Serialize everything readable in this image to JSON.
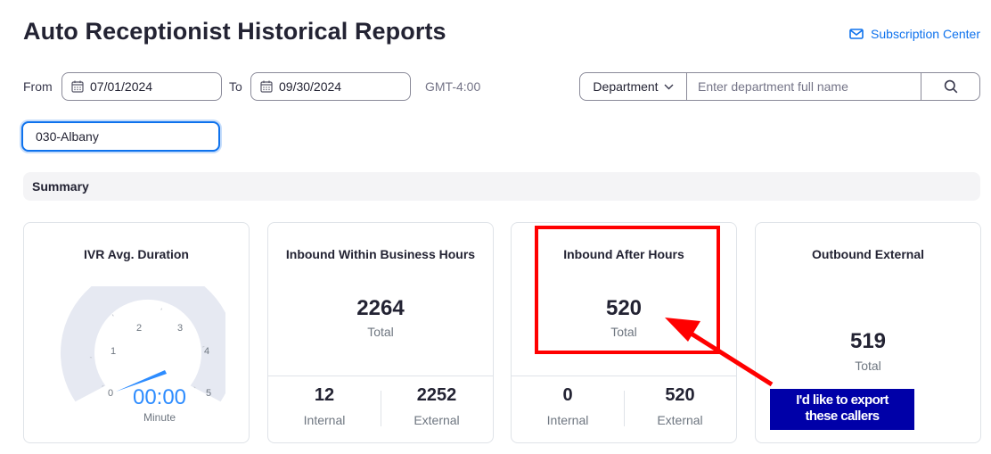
{
  "header": {
    "title": "Auto Receptionist Historical Reports",
    "subscription_label": "Subscription Center"
  },
  "filters": {
    "from_label": "From",
    "from_value": "07/01/2024",
    "to_label": "To",
    "to_value": "09/30/2024",
    "timezone": "GMT-4:00",
    "department_select": "Department",
    "department_placeholder": "Enter department full name",
    "selected_department": "030-Albany"
  },
  "summary": {
    "heading": "Summary",
    "cards": [
      {
        "title": "IVR Avg. Duration",
        "gauge_value": "00:00",
        "gauge_unit": "Minute",
        "ticks": [
          "0",
          "1",
          "2",
          "3",
          "4",
          "5"
        ]
      },
      {
        "title": "Inbound Within Business Hours",
        "total": "2264",
        "total_label": "Total",
        "internal": "12",
        "internal_label": "Internal",
        "external": "2252",
        "external_label": "External"
      },
      {
        "title": "Inbound After Hours",
        "total": "520",
        "total_label": "Total",
        "internal": "0",
        "internal_label": "Internal",
        "external": "520",
        "external_label": "External"
      },
      {
        "title": "Outbound External",
        "total": "519",
        "total_label": "Total"
      }
    ]
  },
  "annotation": {
    "callout_line1": "I'd like to export",
    "callout_line2": "these callers",
    "highlight_color": "#ff0000",
    "callout_bg": "#0000a8"
  },
  "colors": {
    "accent": "#0e72ed",
    "gauge_track": "#e6e9f2",
    "gauge_needle": "#2d8cff"
  }
}
